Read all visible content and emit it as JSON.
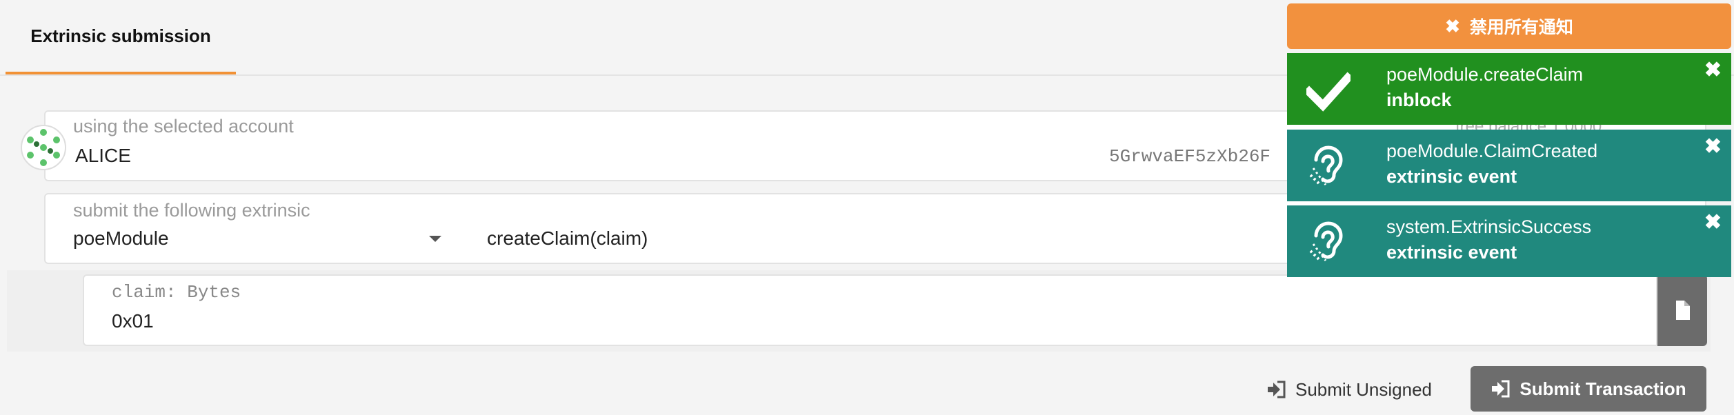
{
  "tabs": [
    {
      "label": "Extrinsic submission"
    }
  ],
  "account": {
    "label": "using the selected account",
    "name": "ALICE",
    "address": "5GrwvaEF5zXb26F",
    "balance_label": "free balance 1.0000"
  },
  "extrinsic": {
    "label": "submit the following extrinsic",
    "module": "poeModule",
    "method": "createClaim(claim)",
    "right_hint": "claim"
  },
  "param": {
    "label": "claim: Bytes",
    "value": "0x01"
  },
  "actions": {
    "unsigned_label": "Submit Unsigned",
    "submit_label": "Submit Transaction"
  },
  "notifications": {
    "dismiss_all_label": "禁用所有通知",
    "items": [
      {
        "title": "poeModule.createClaim",
        "status": "inblock",
        "icon": "check-icon",
        "color": "#21901f"
      },
      {
        "title": "poeModule.ClaimCreated",
        "status": "extrinsic event",
        "icon": "ear-icon",
        "color": "#20897e"
      },
      {
        "title": "system.ExtrinsicSuccess",
        "status": "extrinsic event",
        "icon": "ear-icon",
        "color": "#20897e"
      }
    ]
  },
  "colors": {
    "accent": "#f19135",
    "button": "#6d6d6d"
  }
}
